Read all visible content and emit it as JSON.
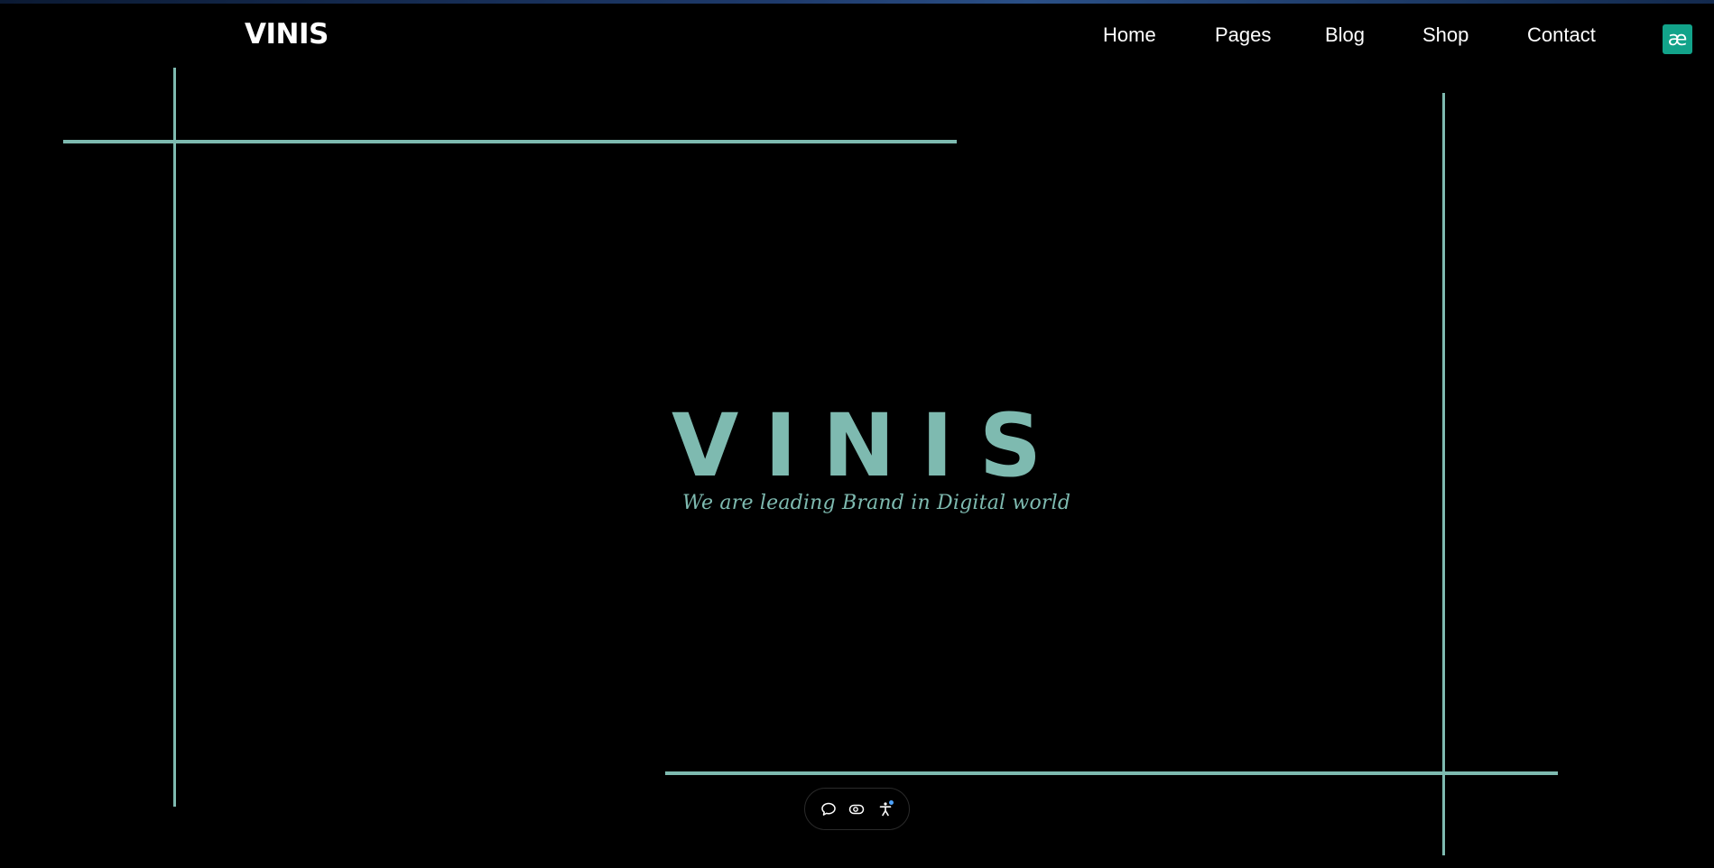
{
  "header": {
    "logo": "VINIS",
    "nav": [
      {
        "label": "Home"
      },
      {
        "label": "Pages"
      },
      {
        "label": "Blog"
      },
      {
        "label": "Shop"
      },
      {
        "label": "Contact"
      }
    ],
    "extension_badge": {
      "glyph": "æ",
      "icon": "extension-icon",
      "color": "#12a38a"
    }
  },
  "hero": {
    "title_letters": [
      "V",
      "I",
      "N",
      "I",
      "S"
    ],
    "tagline": "We are leading Brand in Digital world"
  },
  "toolbar": {
    "buttons": [
      {
        "icon": "chat-bubble-icon"
      },
      {
        "icon": "eye-toggle-icon"
      },
      {
        "icon": "accessibility-icon",
        "badge_color": "#4da3ff"
      }
    ]
  },
  "colors": {
    "background": "#000000",
    "accent": "#7ebab0",
    "text": "#ffffff"
  }
}
